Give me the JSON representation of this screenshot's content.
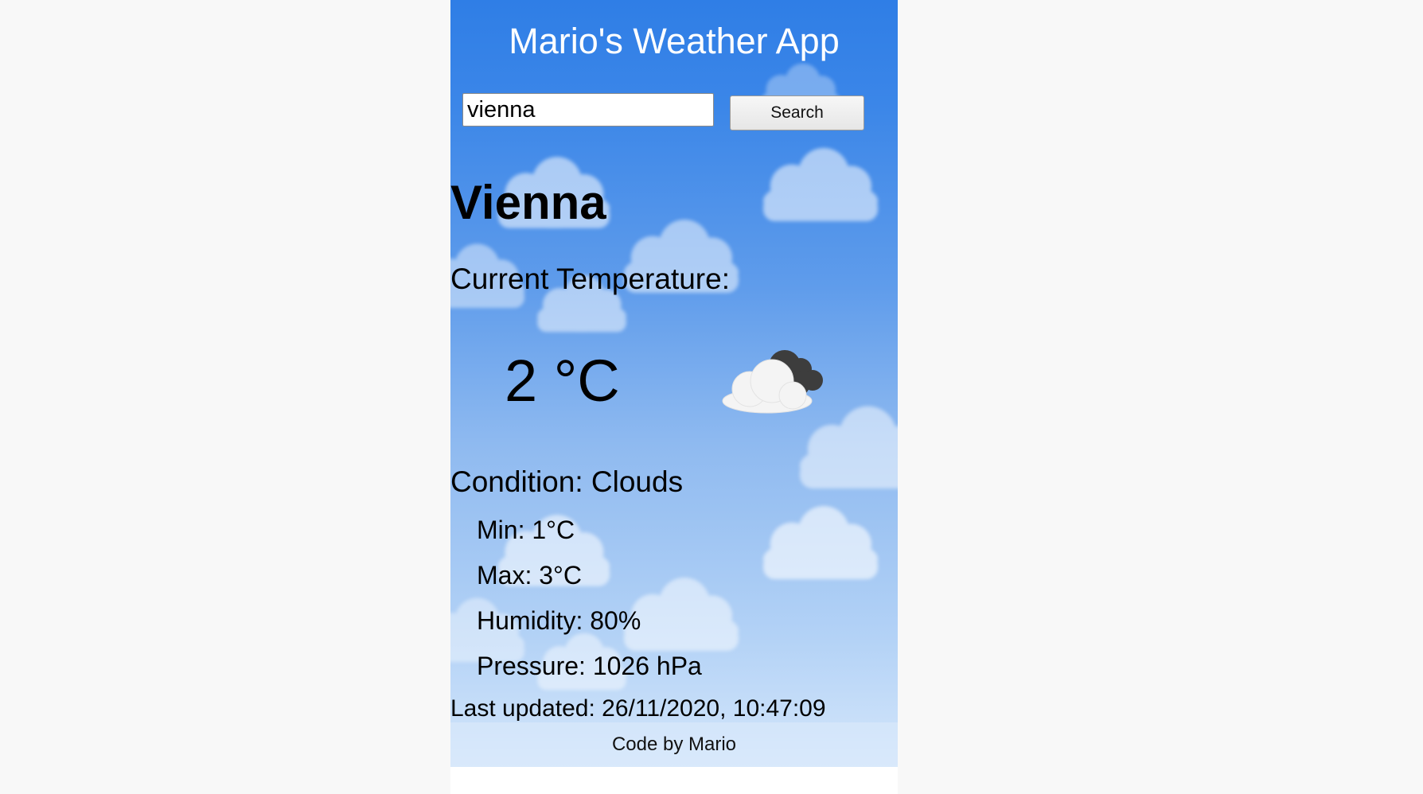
{
  "header": {
    "title": "Mario's Weather App"
  },
  "search": {
    "value": "vienna",
    "button_label": "Search"
  },
  "weather": {
    "city": "Vienna",
    "temperature_label": "Current Temperature:",
    "temperature": "2 °C",
    "condition_label": "Condition:",
    "condition": "Clouds",
    "min_label": "Min:",
    "min": "1°C",
    "max_label": "Max:",
    "max": "3°C",
    "humidity_label": "Humidity:",
    "humidity": "80%",
    "pressure_label": "Pressure:",
    "pressure": "1026 hPa",
    "icon": "broken-clouds-icon"
  },
  "status": {
    "last_updated_label": "Last updated:",
    "last_updated": "26/11/2020, 10:47:09"
  },
  "footer": {
    "credit": "Code by Mario"
  },
  "colors": {
    "header_blue": "#2f7ee6",
    "sky_bottom": "#d4e6fb",
    "page_background": "#f8f8f8"
  }
}
